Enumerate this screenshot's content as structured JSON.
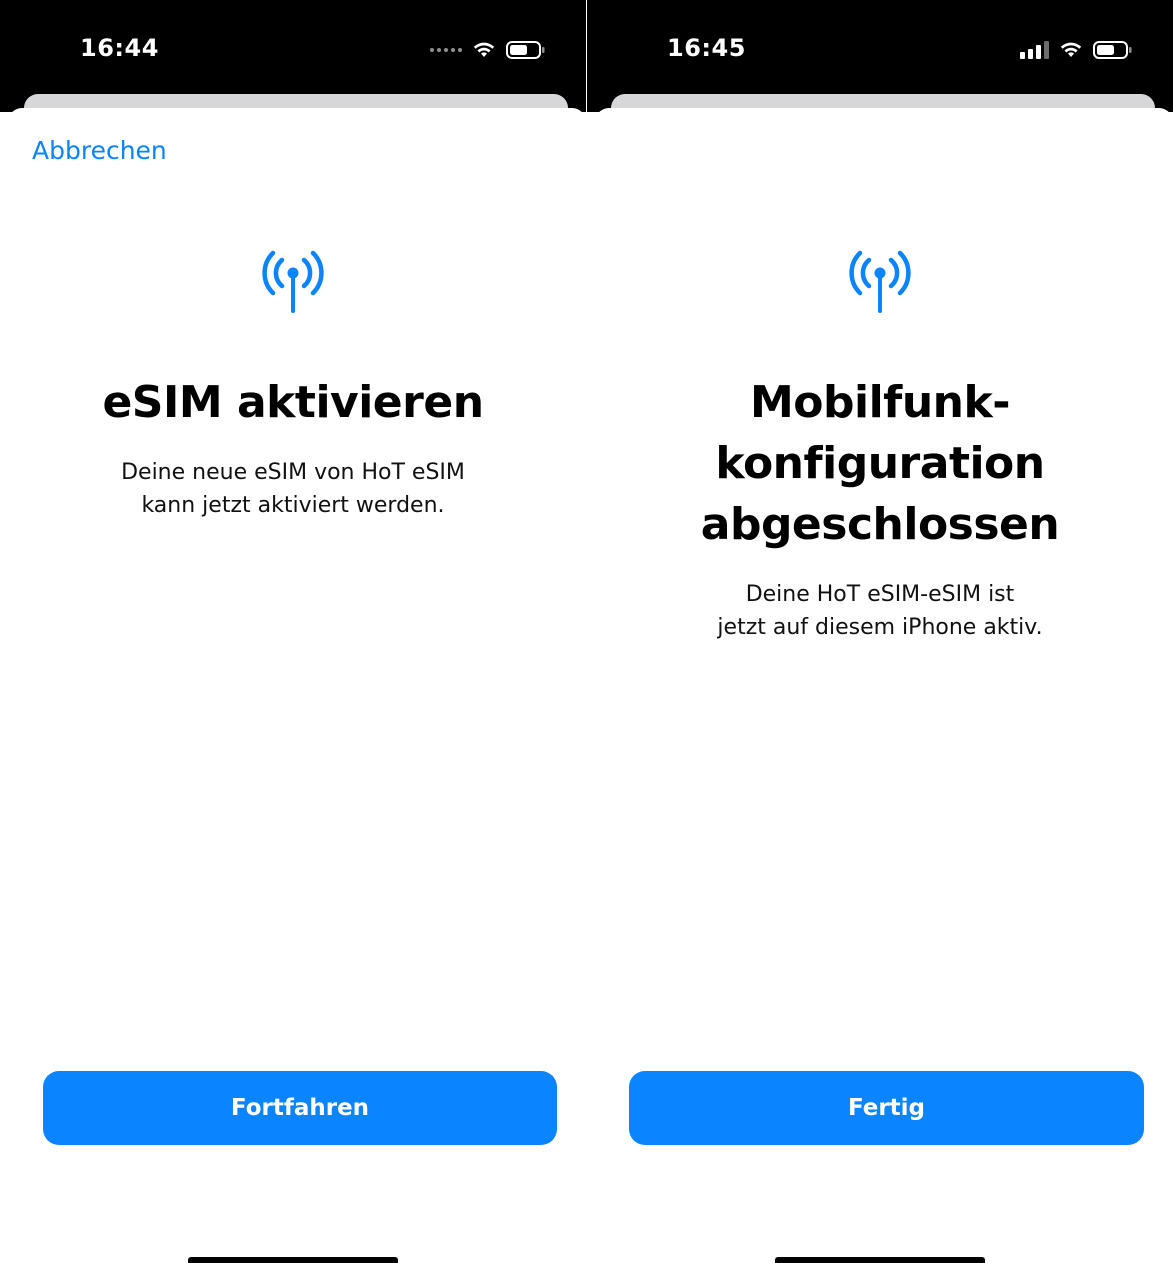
{
  "colors": {
    "accent": "#0a84ff",
    "status_bar": "#000000",
    "sheet_background": "#ffffff",
    "sheet_peek": "#d7d7d9",
    "title_text": "#000000"
  },
  "screens": [
    {
      "status_bar": {
        "time": "16:44",
        "signal": "searching-dots",
        "wifi": "wifi-icon",
        "battery": "battery-icon"
      },
      "nav": {
        "cancel_label": "Abbrechen"
      },
      "icon": "cellular-antenna-icon",
      "title": "eSIM aktivieren",
      "subtitle_lines": [
        "Deine neue eSIM von HoT eSIM",
        "kann jetzt aktiviert werden."
      ],
      "primary_button": "Fortfahren"
    },
    {
      "status_bar": {
        "time": "16:45",
        "signal": "signal-bars",
        "wifi": "wifi-icon",
        "battery": "battery-icon"
      },
      "icon": "cellular-antenna-icon",
      "title_lines": [
        "Mobilfunk-",
        "konfiguration",
        "abgeschlossen"
      ],
      "subtitle_lines": [
        "Deine HoT eSIM-eSIM ist",
        "jetzt auf diesem iPhone aktiv."
      ],
      "primary_button": "Fertig"
    }
  ]
}
